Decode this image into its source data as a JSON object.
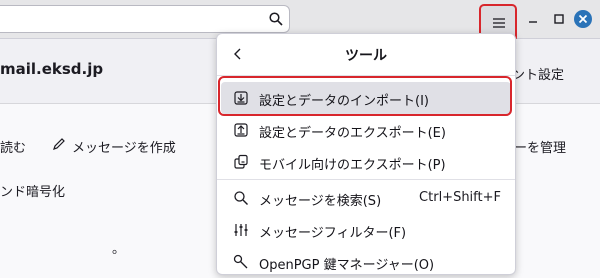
{
  "search": {
    "placeholder": "",
    "value": ""
  },
  "account": {
    "email": "mail.eksd.jp",
    "settings_label": "ント設定"
  },
  "background": {
    "read_label": "読む",
    "write_label": "メッセージを作成",
    "manage_label": "ーを管理",
    "encrypt_label": "ンド暗号化",
    "partial_label": "。"
  },
  "menu": {
    "title": "ツール",
    "items": [
      {
        "label": "設定とデータのインポート(I)",
        "icon": "import-icon",
        "accel": ""
      },
      {
        "label": "設定とデータのエクスポート(E)",
        "icon": "export-icon",
        "accel": ""
      },
      {
        "label": "モバイル向けのエクスポート(P)",
        "icon": "mobile-export-icon",
        "accel": ""
      },
      {
        "label": "メッセージを検索(S)",
        "icon": "search-icon",
        "accel": "Ctrl+Shift+F"
      },
      {
        "label": "メッセージフィルター(F)",
        "icon": "filter-icon",
        "accel": ""
      },
      {
        "label": "OpenPGP 鍵マネージャー(O)",
        "icon": "key-icon",
        "accel": ""
      }
    ]
  },
  "colors": {
    "highlight": "#d8262c",
    "close_button": "#2a73b8"
  }
}
